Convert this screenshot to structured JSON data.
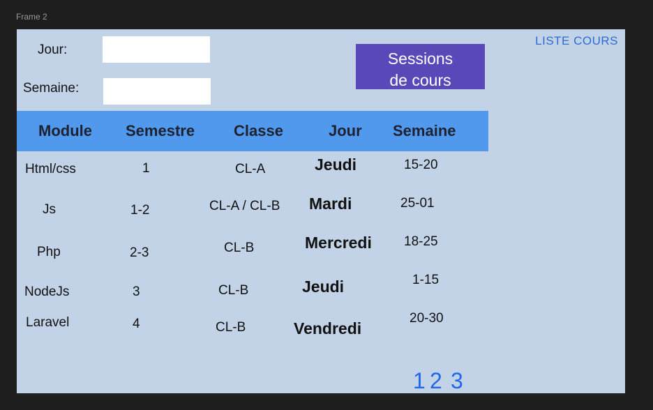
{
  "frame": {
    "label": "Frame 2"
  },
  "form": {
    "jour_label": "Jour:",
    "jour_value": "",
    "semaine_label": "Semaine:",
    "semaine_value": ""
  },
  "actions": {
    "sessions_button": "Sessions\nde cours",
    "liste_link": "LISTE COURS"
  },
  "table": {
    "headers": [
      "Module",
      "Semestre",
      "Classe",
      "Jour",
      "Semaine"
    ],
    "rows": [
      [
        "Html/css",
        "1",
        "CL-A",
        "Jeudi",
        "15-20"
      ],
      [
        "Js",
        "1-2",
        "CL-A / CL-B",
        "Mardi",
        "25-01"
      ],
      [
        "Php",
        "2-3",
        "CL-B",
        "Mercredi",
        "18-25"
      ],
      [
        "NodeJs",
        "3",
        "CL-B",
        "Jeudi",
        "1-15"
      ],
      [
        "Laravel",
        "4",
        "CL-B",
        "Vendredi",
        "20-30"
      ]
    ]
  },
  "pagination": [
    "1",
    "2",
    "3"
  ],
  "colors": {
    "frame_bg": "#c3d3e7",
    "header_bg": "#5199ed",
    "button_bg": "#5848b8",
    "link": "#2e6bd1",
    "pagination": "#2266ee"
  }
}
